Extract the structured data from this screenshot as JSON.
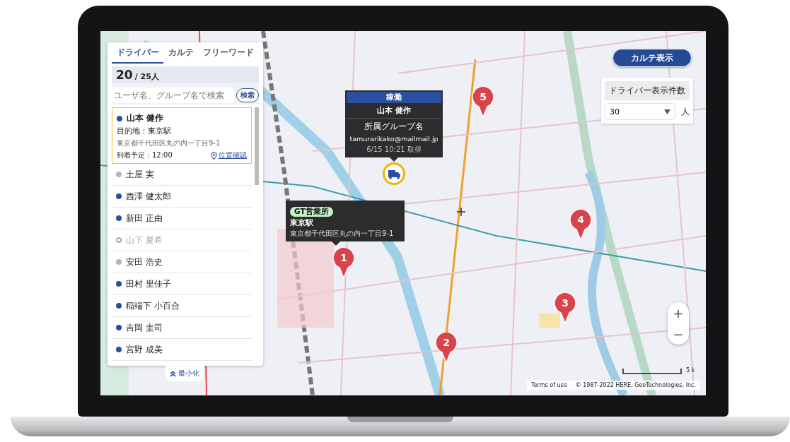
{
  "panel": {
    "tabs": [
      {
        "label": "ドライバー",
        "selected": true
      },
      {
        "label": "カルテ",
        "selected": false
      },
      {
        "label": "フリーワード",
        "selected": false
      }
    ],
    "count": "20",
    "total": "/ 25人",
    "search": {
      "placeholder": "ユーザ名、グループ名で検索",
      "button": "検索"
    },
    "drivers": [
      {
        "name": "山本 健作",
        "color": "#2a4fa0",
        "disabled": false,
        "selected": true,
        "destination": "目的地：東京駅",
        "address": "東京都千代田区丸の内一丁目9-1",
        "eta": "到着予定：12:00",
        "locate_link": "位置確認"
      },
      {
        "name": "土屋 実",
        "color": "#b5b5b5",
        "disabled": false,
        "selected": false
      },
      {
        "name": "西澤 健太郎",
        "color": "#2a4fa0",
        "disabled": false,
        "selected": false
      },
      {
        "name": "新田 正由",
        "color": "#2a4fa0",
        "disabled": false,
        "selected": false
      },
      {
        "name": "山下 夏希",
        "color": "#aaaaaa",
        "disabled": true,
        "selected": false
      },
      {
        "name": "安田 浩史",
        "color": "#b5b5b5",
        "disabled": false,
        "selected": false
      },
      {
        "name": "田村 里佳子",
        "color": "#2a4fa0",
        "disabled": false,
        "selected": false
      },
      {
        "name": "稲端下 小百合",
        "color": "#2a4fa0",
        "disabled": false,
        "selected": false
      },
      {
        "name": "吉岡 圭司",
        "color": "#2a4fa0",
        "disabled": false,
        "selected": false
      },
      {
        "name": "宮野 成美",
        "color": "#2a4fa0",
        "disabled": false,
        "selected": false
      }
    ],
    "minimize": "最小化"
  },
  "karte_button": "カルテ表示",
  "count_setting": {
    "label": "ドライバー表示件数",
    "value": "30",
    "unit": "人"
  },
  "map": {
    "driver_popup": {
      "status": "稼働",
      "name": "山本 健作",
      "group": "所属グループ名",
      "email": "tamurarikako@mailmail.jp",
      "time": "6/15 10:21 取得"
    },
    "office_popup": {
      "tag": "GT営業所",
      "name": "東京駅",
      "address": "東京都千代田区丸の内一丁目9-1"
    },
    "markers": [
      {
        "label": "1"
      },
      {
        "label": "2"
      },
      {
        "label": "3"
      },
      {
        "label": "4"
      },
      {
        "label": "5"
      }
    ],
    "zoom_in": "+",
    "zoom_out": "−",
    "scale_label": "5 k",
    "terms": "Terms of use",
    "copyright": "© 1987-2022 HERE, GeoTechnologies, Inc."
  }
}
